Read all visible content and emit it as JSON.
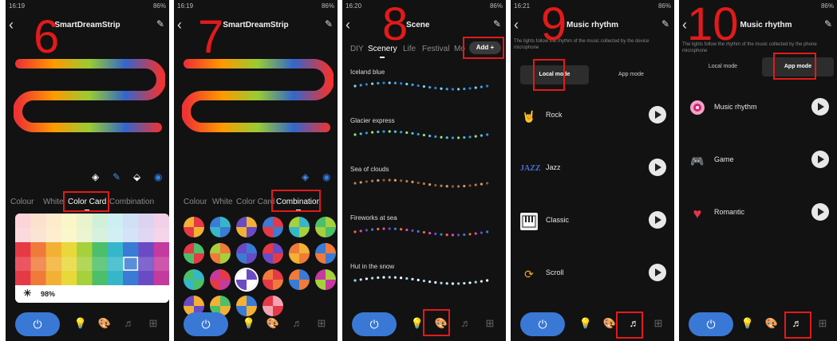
{
  "status": {
    "p6": {
      "time": "16:19",
      "sys": "86%"
    },
    "p7": {
      "time": "16:19",
      "sys": "86%"
    },
    "p8": {
      "time": "16:20",
      "sys": "86%"
    },
    "p9": {
      "time": "16:21",
      "sys": "86%"
    },
    "p10": {
      "time": "",
      "sys": "86%"
    }
  },
  "steps": [
    "6",
    "7",
    "8",
    "9",
    "10"
  ],
  "panel6": {
    "title": "SmartDreamStrip",
    "tabs": [
      "Colour",
      "White",
      "Color Card",
      "Combination"
    ],
    "active_tab": "Color Card",
    "brightness": "98%"
  },
  "panel7": {
    "title": "SmartDreamStrip",
    "tabs": [
      "Colour",
      "White",
      "Color Card",
      "Combination"
    ],
    "active_tab": "Combination"
  },
  "panel8": {
    "title": "Scene",
    "tabs": [
      "DIY",
      "Scenery",
      "Life",
      "Festival",
      "Mo"
    ],
    "active_tab": "Scenery",
    "add_button": "Add +",
    "scenes": [
      "Iceland blue",
      "Glacier express",
      "Sea of clouds",
      "Fireworks at sea",
      "Hut in the snow"
    ]
  },
  "panel9": {
    "title": "Music rhythm",
    "description": "The lights follow the rhythm of the music collected by the device microphone",
    "modes": [
      "Local mode",
      "App mode"
    ],
    "active_mode": "Local mode",
    "items": [
      "Rock",
      "Jazz",
      "Classic",
      "Scroll"
    ],
    "jazz_icon_text": "JAZZ"
  },
  "panel10": {
    "title": "Music rhythm",
    "description": "The lights follow the rhythm of the music collected by the phone microphone",
    "modes": [
      "Local mode",
      "App mode"
    ],
    "active_mode": "App mode",
    "items": [
      "Music rhythm",
      "Game",
      "Romantic"
    ]
  },
  "icons": {
    "back": "‹",
    "edit": "✎",
    "power": "⏻",
    "bulb": "💡",
    "palette": "🎨",
    "music": "♬",
    "grid": "⊞",
    "sun": "☀"
  },
  "colors": {
    "accent_red": "#e31a1a",
    "power_blue": "#3a78d6"
  }
}
